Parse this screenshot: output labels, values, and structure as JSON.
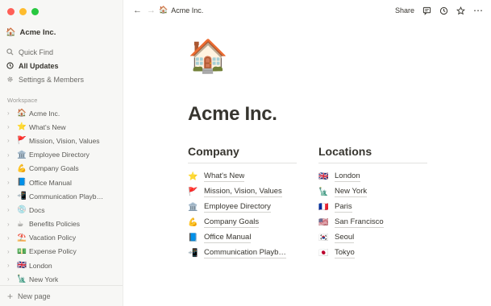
{
  "sidebar": {
    "workspace": {
      "emoji": "🏠",
      "name": "Acme Inc."
    },
    "quick_find": "Quick Find",
    "all_updates": "All Updates",
    "settings": "Settings & Members",
    "section_label": "Workspace",
    "pages": [
      {
        "emoji": "🏠",
        "title": "Acme Inc."
      },
      {
        "emoji": "⭐",
        "title": "What's New"
      },
      {
        "emoji": "🚩",
        "title": "Mission, Vision, Values"
      },
      {
        "emoji": "🏛️",
        "title": "Employee Directory"
      },
      {
        "emoji": "💪",
        "title": "Company Goals"
      },
      {
        "emoji": "📘",
        "title": "Office Manual"
      },
      {
        "emoji": "📲",
        "title": "Communication Playb…"
      },
      {
        "emoji": "💿",
        "title": "Docs"
      },
      {
        "emoji": "☕",
        "title": "Benefits Policies"
      },
      {
        "emoji": "⛱️",
        "title": "Vacation Policy"
      },
      {
        "emoji": "💵",
        "title": "Expense Policy"
      },
      {
        "emoji": "🇬🇧",
        "title": "London"
      },
      {
        "emoji": "🗽",
        "title": "New York"
      }
    ],
    "new_page": "New page"
  },
  "topbar": {
    "crumb_emoji": "🏠",
    "crumb_title": "Acme Inc.",
    "share_label": "Share"
  },
  "page": {
    "icon": "🏠",
    "title": "Acme Inc.",
    "company": {
      "heading": "Company",
      "links": [
        {
          "emoji": "⭐",
          "title": "What's New"
        },
        {
          "emoji": "🚩",
          "title": "Mission, Vision, Values"
        },
        {
          "emoji": "🏛️",
          "title": "Employee Directory"
        },
        {
          "emoji": "💪",
          "title": "Company Goals"
        },
        {
          "emoji": "📘",
          "title": "Office Manual"
        },
        {
          "emoji": "📲",
          "title": "Communication Playb…"
        }
      ]
    },
    "locations": {
      "heading": "Locations",
      "links": [
        {
          "emoji": "🇬🇧",
          "title": "London"
        },
        {
          "emoji": "🗽",
          "title": "New York"
        },
        {
          "emoji": "🇫🇷",
          "title": "Paris"
        },
        {
          "emoji": "🇺🇸",
          "title": "San Francisco"
        },
        {
          "emoji": "🇰🇷",
          "title": "Seoul"
        },
        {
          "emoji": "🇯🇵",
          "title": "Tokyo"
        }
      ]
    }
  },
  "icons": {
    "search": "search-icon",
    "clock": "clock-icon",
    "gear": "gear-icon",
    "comment": "comment-icon",
    "history": "history-icon",
    "star": "star-icon",
    "more": "more-icon"
  }
}
